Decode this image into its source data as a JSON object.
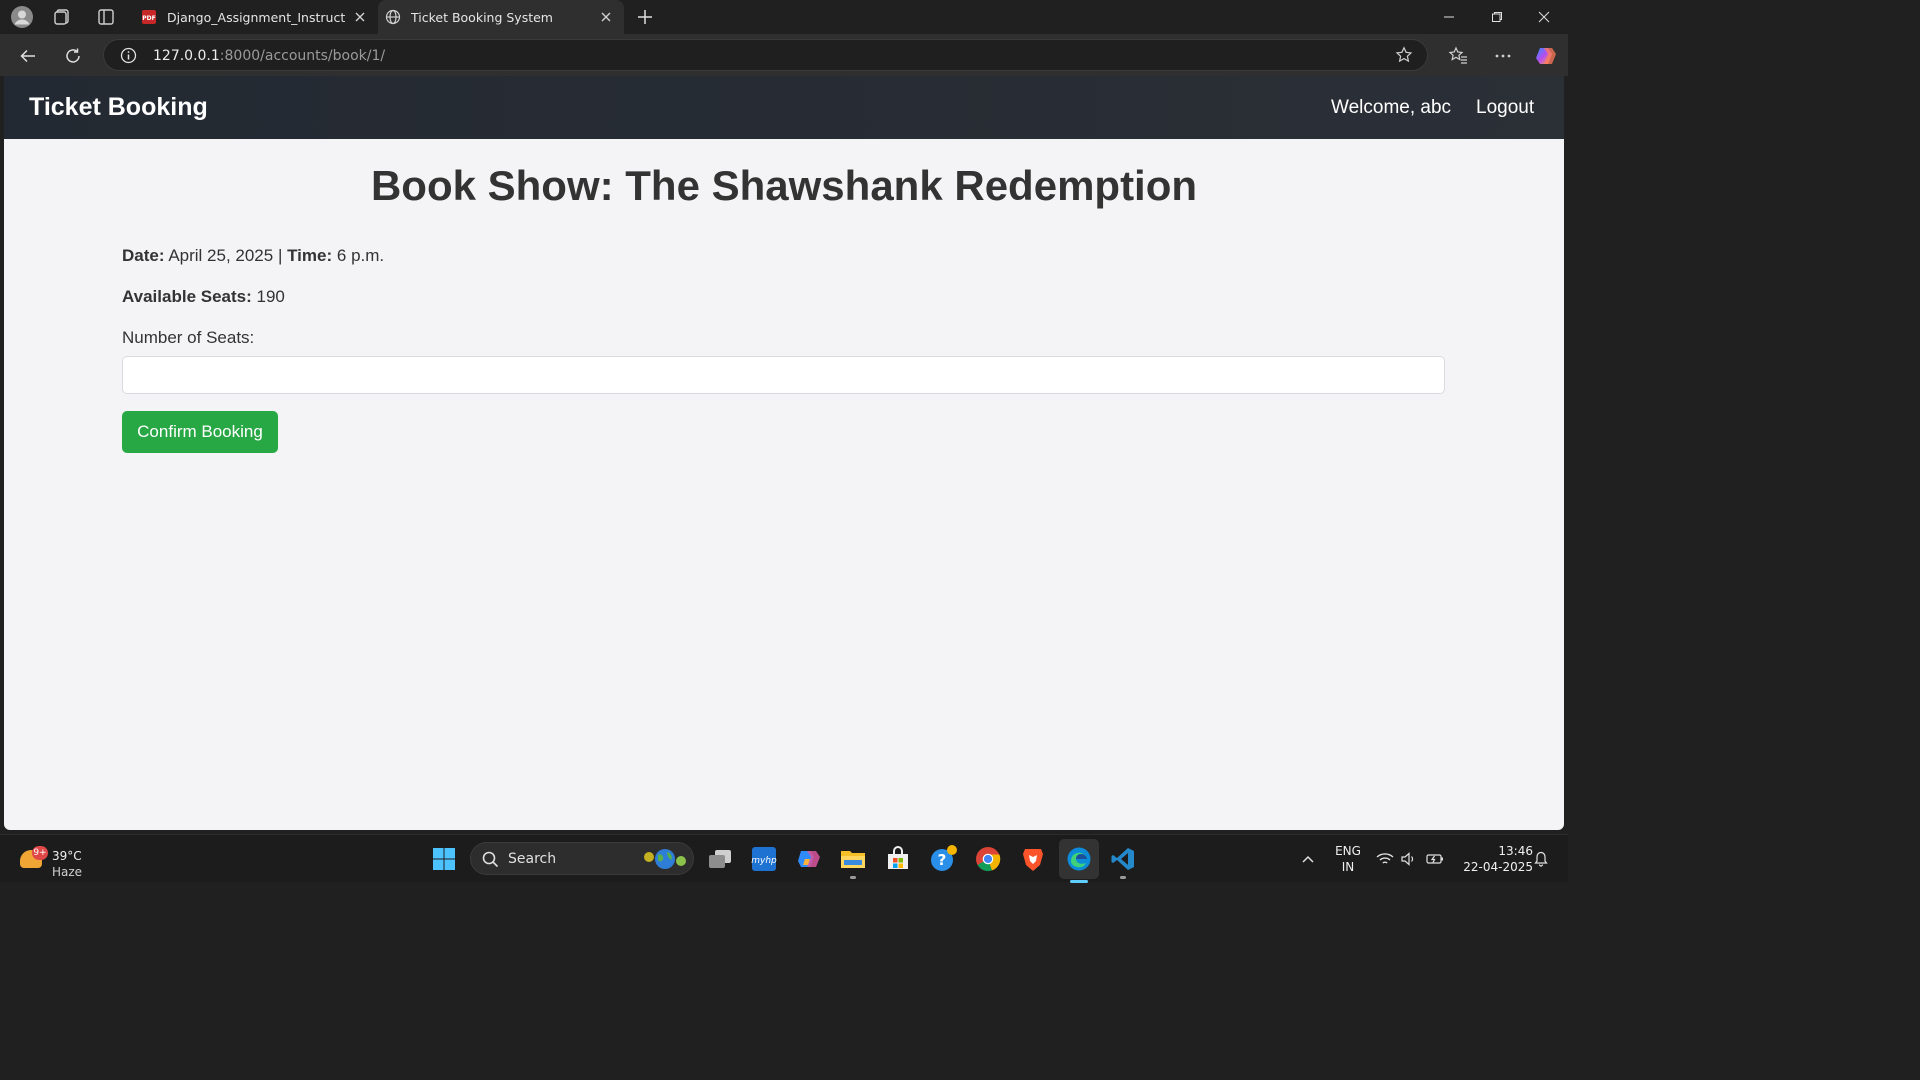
{
  "browser": {
    "tabs": [
      {
        "title": "Django_Assignment_Instructions_",
        "icon": "pdf-icon",
        "active": false
      },
      {
        "title": "Ticket Booking System",
        "icon": "globe-icon",
        "active": true
      }
    ],
    "url_host": "127.0.0.1",
    "url_rest": ":8000/accounts/book/1/"
  },
  "site": {
    "brand": "Ticket Booking",
    "welcome": "Welcome, abc",
    "logout": "Logout"
  },
  "booking": {
    "title": "Book Show: The Shawshank Redemption",
    "date_label": "Date:",
    "date_value": "April 25, 2025",
    "separator": "|",
    "time_label": "Time:",
    "time_value": "6 p.m.",
    "seats_label": "Available Seats:",
    "seats_value": "190",
    "input_label": "Number of Seats:",
    "input_value": "",
    "confirm": "Confirm Booking"
  },
  "taskbar": {
    "weather_badge": "9+",
    "temperature": "39°C",
    "condition": "Haze",
    "search": "Search",
    "lang_top": "ENG",
    "lang_bottom": "IN",
    "time": "13:46",
    "date": "22-04-2025"
  },
  "colors": {
    "confirm_button": "#28a745",
    "site_nav": "#262b33",
    "page_bg": "#f4f4f6"
  }
}
